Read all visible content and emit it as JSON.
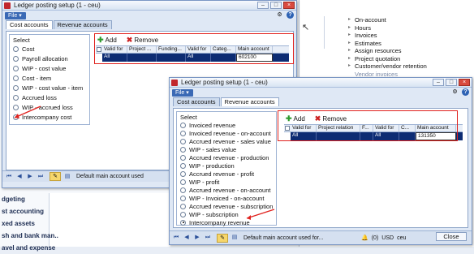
{
  "colors": {
    "accent": "#0d2c73",
    "highlight_box": "#e0201c",
    "file_menu": "#3a69b5"
  },
  "right_list": [
    "On-account",
    "Hours",
    "Invoices",
    "Estimates",
    "Assign resources",
    "Project quotation",
    "Customer/vendor retention",
    "Vendor invoices"
  ],
  "left_nav": [
    "dgeting",
    "st accounting",
    "xed assets",
    "sh and bank man..",
    "avel and expense"
  ],
  "win1": {
    "title": "Ledger posting setup (1 - ceu)",
    "file": "File",
    "tabs": [
      "Cost accounts",
      "Revenue accounts"
    ],
    "select_label": "Select",
    "options": [
      "Cost",
      "Payroll allocation",
      "WIP - cost value",
      "Cost - item",
      "WIP - cost value - item",
      "Accrued loss",
      "WIP - accrued loss",
      "Intercompany cost"
    ],
    "add": "Add",
    "remove": "Remove",
    "headers": [
      "Valid for",
      "Project ...",
      "Funding...",
      "Valid for",
      "Categ...",
      "Main account"
    ],
    "row": [
      "All",
      "",
      "",
      "All",
      "",
      "602100"
    ],
    "footer_msg": "Default main account used"
  },
  "win2": {
    "title": "Ledger posting setup (1 - ceu)",
    "file": "File",
    "tabs": [
      "Cost accounts",
      "Revenue accounts"
    ],
    "select_label": "Select",
    "options": [
      "Invoiced revenue",
      "Invoiced revenue - on-account",
      "Accrued revenue - sales value",
      "WIP - sales value",
      "Accrued revenue - production",
      "WIP - production",
      "Accrued revenue - profit",
      "WIP - profit",
      "Accrued revenue - on-account",
      "WIP - Invoiced - on-account",
      "Accrued revenue - subscription",
      "WIP - subscription",
      "Intercompany revenue"
    ],
    "add": "Add",
    "remove": "Remove",
    "headers": [
      "Valid for",
      "Project relation",
      "F...",
      "Valid for",
      "C...",
      "Main account"
    ],
    "row": [
      "All",
      "",
      "",
      "All",
      "",
      "131350"
    ],
    "footer_msg": "Default main account used for...",
    "status_count": "(0)",
    "currency": "USD",
    "company": "ceu",
    "close": "Close"
  }
}
